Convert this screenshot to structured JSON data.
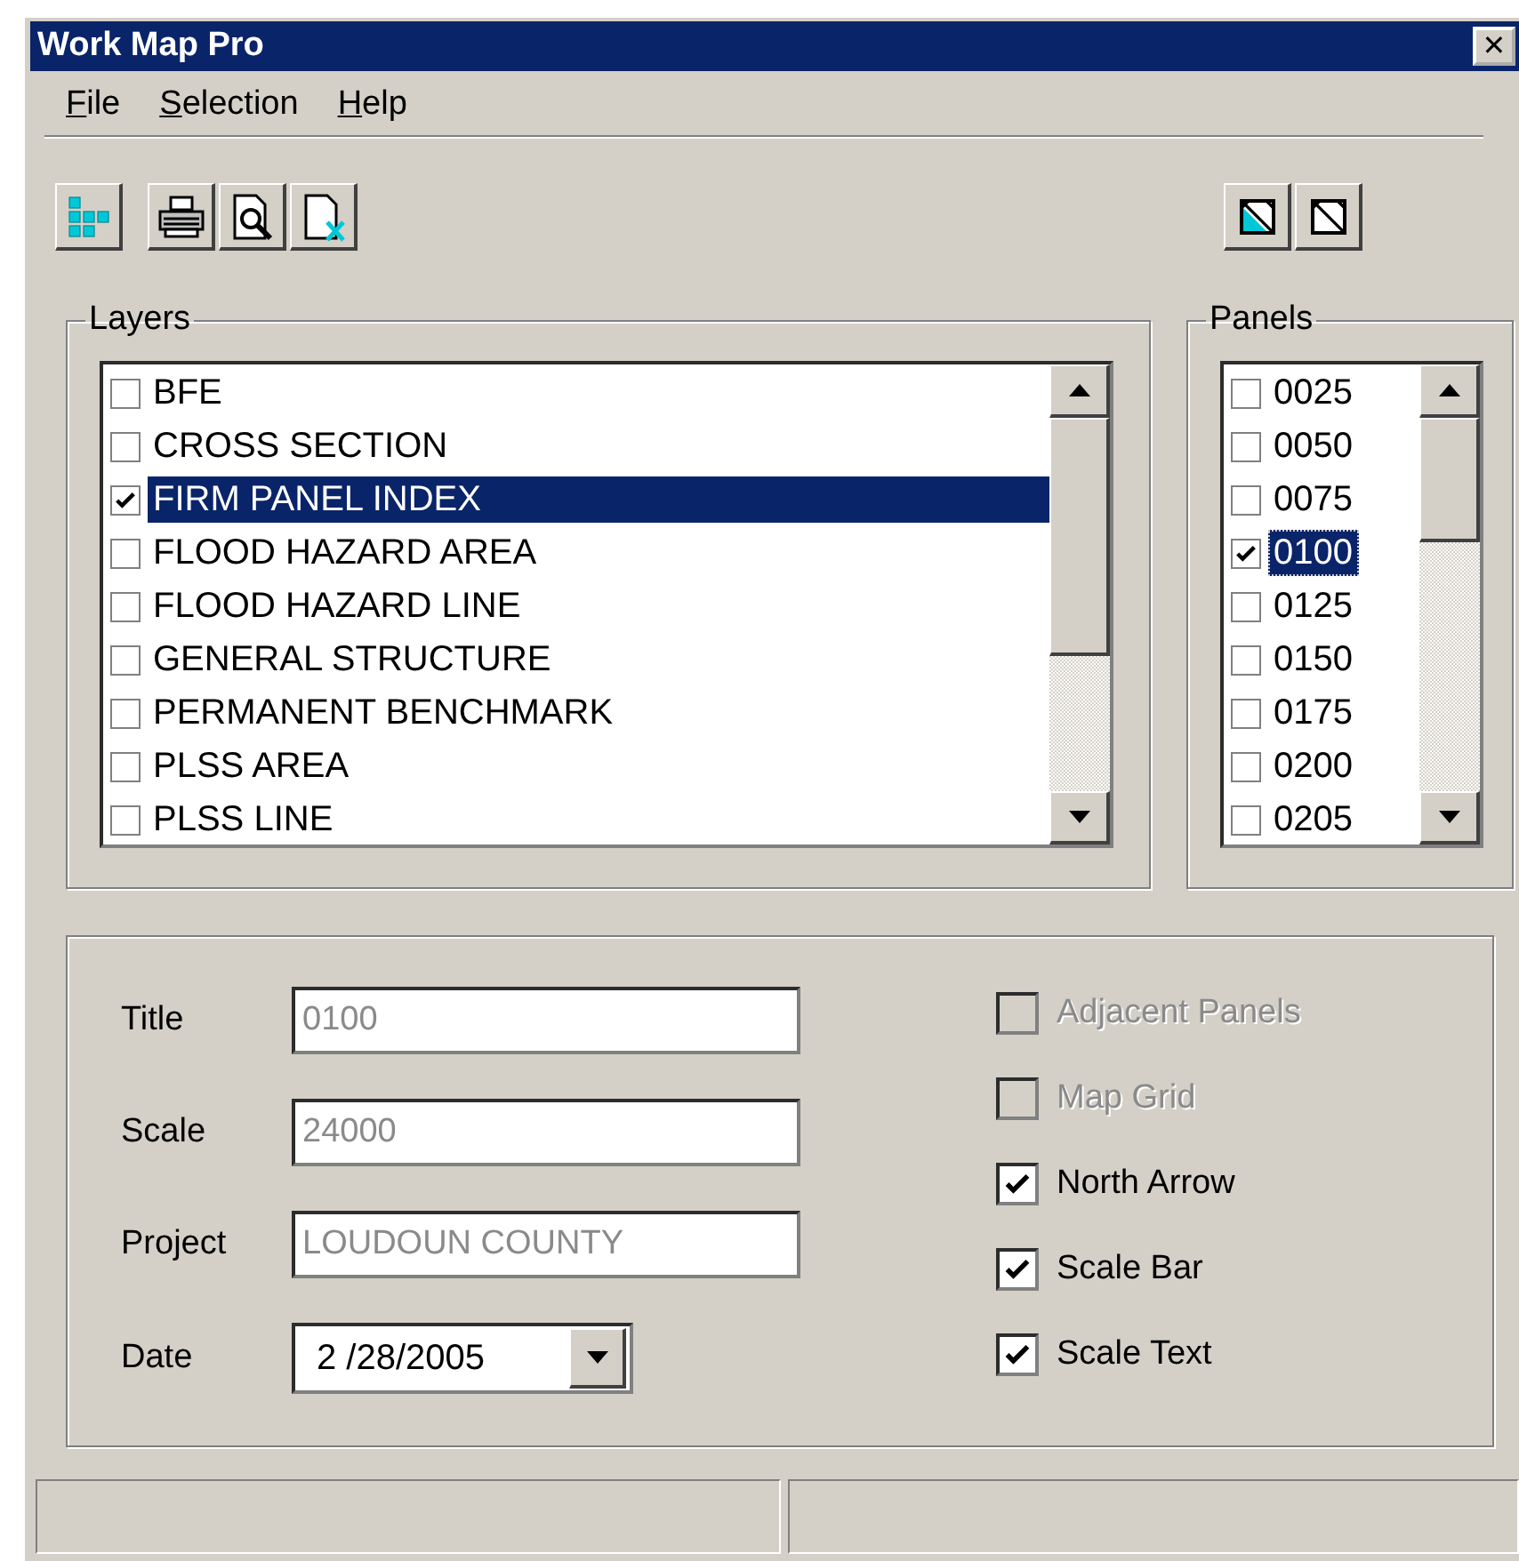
{
  "window": {
    "title": "Work Map Pro",
    "close": "✕"
  },
  "menu": [
    {
      "label": "File"
    },
    {
      "label": "Selection"
    },
    {
      "label": "Help"
    }
  ],
  "toolbar": {
    "left": [
      {
        "kind": "grid"
      },
      {
        "kind": "gap"
      },
      {
        "kind": "printer"
      },
      {
        "kind": "preview"
      },
      {
        "kind": "page-x"
      }
    ],
    "right": [
      {
        "kind": "square-filled"
      },
      {
        "kind": "square-empty"
      }
    ]
  },
  "layers": {
    "title": "Layers",
    "items": [
      {
        "label": "BFE",
        "checked": false,
        "selected": false
      },
      {
        "label": "CROSS SECTION",
        "checked": false,
        "selected": false
      },
      {
        "label": "FIRM PANEL INDEX",
        "checked": true,
        "selected": true
      },
      {
        "label": "FLOOD HAZARD AREA",
        "checked": false,
        "selected": false
      },
      {
        "label": "FLOOD HAZARD LINE",
        "checked": false,
        "selected": false
      },
      {
        "label": "GENERAL STRUCTURE",
        "checked": false,
        "selected": false
      },
      {
        "label": "PERMANENT BENCHMARK",
        "checked": false,
        "selected": false
      },
      {
        "label": "PLSS AREA",
        "checked": false,
        "selected": false
      },
      {
        "label": "PLSS LINE",
        "checked": false,
        "selected": false
      }
    ]
  },
  "panels": {
    "title": "Panels",
    "items": [
      {
        "label": "0025",
        "checked": false,
        "selected": false
      },
      {
        "label": "0050",
        "checked": false,
        "selected": false
      },
      {
        "label": "0075",
        "checked": false,
        "selected": false
      },
      {
        "label": "0100",
        "checked": true,
        "selected": true
      },
      {
        "label": "0125",
        "checked": false,
        "selected": false
      },
      {
        "label": "0150",
        "checked": false,
        "selected": false
      },
      {
        "label": "0175",
        "checked": false,
        "selected": false
      },
      {
        "label": "0200",
        "checked": false,
        "selected": false
      },
      {
        "label": "0205",
        "checked": false,
        "selected": false
      }
    ]
  },
  "fields": [
    {
      "label": "Title",
      "kind": "text",
      "value": "0100",
      "disabled": true
    },
    {
      "label": "Scale",
      "kind": "text",
      "value": "24000",
      "disabled": true
    },
    {
      "label": "Project",
      "kind": "text",
      "value": "LOUDOUN COUNTY",
      "disabled": true
    },
    {
      "label": "Date",
      "kind": "date",
      "value": "2 /28/2005",
      "disabled": false
    }
  ],
  "options": [
    {
      "label": "Adjacent Panels",
      "checked": false,
      "disabled": true
    },
    {
      "label": "Map Grid",
      "checked": false,
      "disabled": true
    },
    {
      "label": "North Arrow",
      "checked": true,
      "disabled": false
    },
    {
      "label": "Scale Bar",
      "checked": true,
      "disabled": false
    },
    {
      "label": "Scale Text",
      "checked": true,
      "disabled": false
    }
  ]
}
